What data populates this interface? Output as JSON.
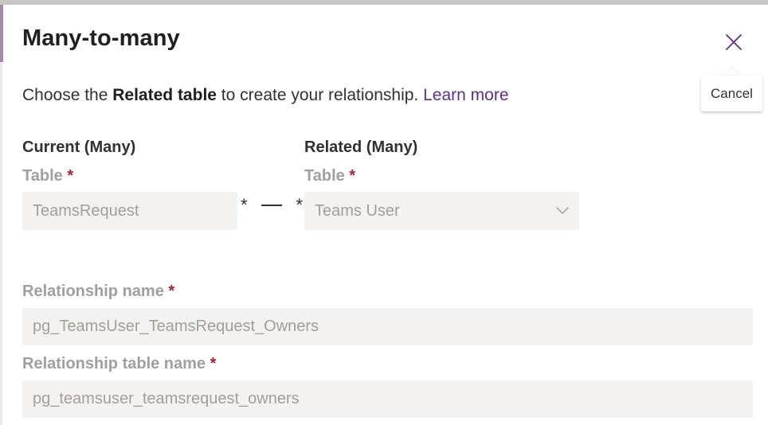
{
  "dialog": {
    "title": "Many-to-many",
    "close_tooltip": "Cancel",
    "description": {
      "prefix": "Choose the ",
      "bold": "Related table",
      "middle": " to create your relationship. ",
      "link": "Learn more"
    },
    "required_marker": "*"
  },
  "current": {
    "heading": "Current (Many)",
    "table_label": "Table",
    "table_value": "TeamsRequest"
  },
  "connector": {
    "left": "*",
    "right": "*"
  },
  "related": {
    "heading": "Related (Many)",
    "table_label": "Table",
    "table_value": "Teams User"
  },
  "relationship": {
    "name_label": "Relationship name",
    "name_value": "pg_TeamsUser_TeamsRequest_Owners",
    "table_name_label": "Relationship table name",
    "table_name_value": "pg_teamsuser_teamsrequest_owners"
  },
  "icons": {
    "close": "close-icon",
    "dropdown": "chevron-down-icon"
  },
  "colors": {
    "accent": "#5c2e91",
    "required": "#a4262c",
    "disabled_text": "#a19f9d",
    "disabled_bg": "#f3f2f1"
  }
}
